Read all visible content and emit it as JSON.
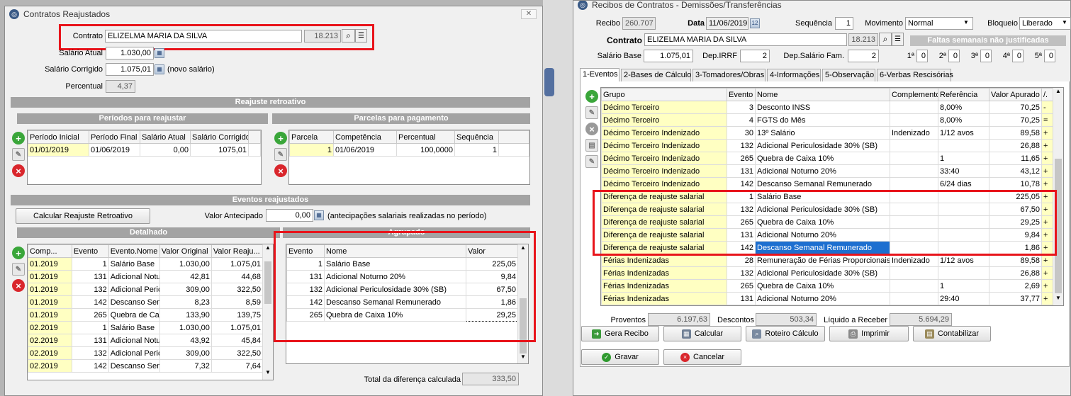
{
  "left": {
    "title": "Contratos Reajustados",
    "contrato_label": "Contrato",
    "contrato_name": "ELIZELMA MARIA DA SILVA",
    "contrato_code": "18.213",
    "salario_atual_label": "Salário Atual",
    "salario_atual": "1.030,00",
    "salario_corrigido_label": "Salário Corrigido",
    "salario_corrigido": "1.075,01",
    "novo_salario_note": "(novo salário)",
    "percentual_label": "Percentual",
    "percentual": "4,37",
    "reajuste_header": "Reajuste retroativo",
    "periodos_header": "Períodos para reajustar",
    "parcelas_header": "Parcelas para pagamento",
    "periodos_cols": [
      "Período Inicial",
      "Período Final",
      "Salário Atual",
      "Salário Corrigido"
    ],
    "periodos_rows": [
      [
        "01/01/2019",
        "01/06/2019",
        "0,00",
        "1075,01"
      ]
    ],
    "parcelas_cols": [
      "Parcela",
      "Competência",
      "Percentual",
      "Sequência"
    ],
    "parcelas_rows": [
      [
        "1",
        "01/06/2019",
        "100,0000",
        "1"
      ]
    ],
    "eventos_header": "Eventos reajustados",
    "calc_button": "Calcular Reajuste Retroativo",
    "valor_antecipado_label": "Valor Antecipado",
    "valor_antecipado": "0,00",
    "antecipacoes_note": "(antecipações salariais realizadas no período)",
    "detalhado_header": "Detalhado",
    "agrupado_header": "Agrupado",
    "detalhado_cols": [
      "Comp...",
      "Evento",
      "Evento.Nome",
      "Valor Original",
      "Valor Reaju..."
    ],
    "detalhado_rows": [
      [
        "01.2019",
        "1",
        "Salário Base",
        "1.030,00",
        "1.075,01"
      ],
      [
        "01.2019",
        "131",
        "Adicional Notu",
        "42,81",
        "44,68"
      ],
      [
        "01.2019",
        "132",
        "Adicional Peric",
        "309,00",
        "322,50"
      ],
      [
        "01.2019",
        "142",
        "Descanso Sem",
        "8,23",
        "8,59"
      ],
      [
        "01.2019",
        "265",
        "Quebra de Cai",
        "133,90",
        "139,75"
      ],
      [
        "02.2019",
        "1",
        "Salário Base",
        "1.030,00",
        "1.075,01"
      ],
      [
        "02.2019",
        "131",
        "Adicional Notu",
        "43,92",
        "45,84"
      ],
      [
        "02.2019",
        "132",
        "Adicional Peric",
        "309,00",
        "322,50"
      ],
      [
        "02.2019",
        "142",
        "Descanso Sem",
        "7,32",
        "7,64"
      ]
    ],
    "agrupado_cols": [
      "Evento",
      "Nome",
      "Valor"
    ],
    "agrupado_rows": [
      [
        "1",
        "Salário Base",
        "225,05"
      ],
      [
        "131",
        "Adicional Noturno 20%",
        "9,84"
      ],
      [
        "132",
        "Adicional Periculosidade 30% (SB)",
        "67,50"
      ],
      [
        "142",
        "Descanso Semanal Remunerado",
        "1,86"
      ],
      [
        "265",
        "Quebra de Caixa 10%",
        "29,25"
      ]
    ],
    "total_label": "Total da diferença calculada",
    "total_value": "333,50"
  },
  "right": {
    "title": "Recibos de Contratos - Demissões/Transferências",
    "recibo_label": "Recibo",
    "recibo": "260.707",
    "data_label": "Data",
    "data": "11/06/2019",
    "sequencia_label": "Sequência",
    "sequencia": "1",
    "movimento_label": "Movimento",
    "movimento": "Normal",
    "bloqueio_label": "Bloqueio",
    "bloqueio": "Liberado",
    "contrato_label": "Contrato",
    "contrato_name": "ELIZELMA MARIA DA SILVA",
    "contrato_code": "18.213",
    "faltas_header": "Faltas semanais não justificadas",
    "salario_base_label": "Salário Base",
    "salario_base": "1.075,01",
    "dep_irrf_label": "Dep.IRRF",
    "dep_irrf": "2",
    "dep_salario_label": "Dep.Salário Fam.",
    "dep_salario": "2",
    "faltas": [
      {
        "label": "1ª",
        "value": "0"
      },
      {
        "label": "2ª",
        "value": "0"
      },
      {
        "label": "3ª",
        "value": "0"
      },
      {
        "label": "4ª",
        "value": "0"
      },
      {
        "label": "5ª",
        "value": "0"
      }
    ],
    "tabs": [
      "1-Eventos",
      "2-Bases de Cálculo",
      "3-Tomadores/Obras",
      "4-Informações",
      "5-Observação",
      "6-Verbas Rescisórias"
    ],
    "cols": [
      "Grupo",
      "Evento",
      "Nome",
      "Complemento",
      "Referência",
      "Valor Apurado",
      "/."
    ],
    "rows": [
      [
        "Décimo Terceiro",
        "3",
        "Desconto INSS",
        "",
        "8,00%",
        "70,25",
        "-"
      ],
      [
        "Décimo Terceiro",
        "4",
        "FGTS do Mês",
        "",
        "8,00%",
        "70,25",
        "="
      ],
      [
        "Décimo Terceiro Indenizado",
        "30",
        "13º Salário",
        "Indenizado",
        "1/12 avos",
        "89,58",
        "+"
      ],
      [
        "Décimo Terceiro Indenizado",
        "132",
        "Adicional Periculosidade 30% (SB)",
        "",
        "",
        "26,88",
        "+"
      ],
      [
        "Décimo Terceiro Indenizado",
        "265",
        "Quebra de Caixa 10%",
        "",
        "1",
        "11,65",
        "+"
      ],
      [
        "Décimo Terceiro Indenizado",
        "131",
        "Adicional Noturno 20%",
        "",
        "33:40",
        "43,12",
        "+"
      ],
      [
        "Décimo Terceiro Indenizado",
        "142",
        "Descanso Semanal Remunerado",
        "",
        "6/24 dias",
        "10,78",
        "+"
      ],
      [
        "Diferença de reajuste salarial",
        "1",
        "Salário Base",
        "",
        "",
        "225,05",
        "+"
      ],
      [
        "Diferença de reajuste salarial",
        "132",
        "Adicional Periculosidade 30% (SB)",
        "",
        "",
        "67,50",
        "+"
      ],
      [
        "Diferença de reajuste salarial",
        "265",
        "Quebra de Caixa 10%",
        "",
        "",
        "29,25",
        "+"
      ],
      [
        "Diferença de reajuste salarial",
        "131",
        "Adicional Noturno 20%",
        "",
        "",
        "9,84",
        "+"
      ],
      [
        "Diferença de reajuste salarial",
        "142",
        "Descanso Semanal Remunerado",
        "",
        "",
        "1,86",
        "+"
      ],
      [
        "Férias Indenizadas",
        "28",
        "Remuneração de Férias Proporcionais",
        "Indenizado",
        "1/12 avos",
        "89,58",
        "+"
      ],
      [
        "Férias Indenizadas",
        "132",
        "Adicional Periculosidade 30% (SB)",
        "",
        "",
        "26,88",
        "+"
      ],
      [
        "Férias Indenizadas",
        "265",
        "Quebra de Caixa 10%",
        "",
        "1",
        "2,69",
        "+"
      ],
      [
        "Férias Indenizadas",
        "131",
        "Adicional Noturno 20%",
        "",
        "29:40",
        "37,77",
        "+"
      ]
    ],
    "proventos_label": "Proventos",
    "proventos": "6.197,63",
    "descontos_label": "Descontos",
    "descontos": "503,34",
    "liquido_label": "Líquido a Receber",
    "liquido": "5.694,29",
    "buttons": [
      "Gera Recibo",
      "Calcular",
      "Roteiro Cálculo",
      "Imprimir",
      "Contabilizar"
    ],
    "gravar": "Gravar",
    "cancelar": "Cancelar"
  }
}
